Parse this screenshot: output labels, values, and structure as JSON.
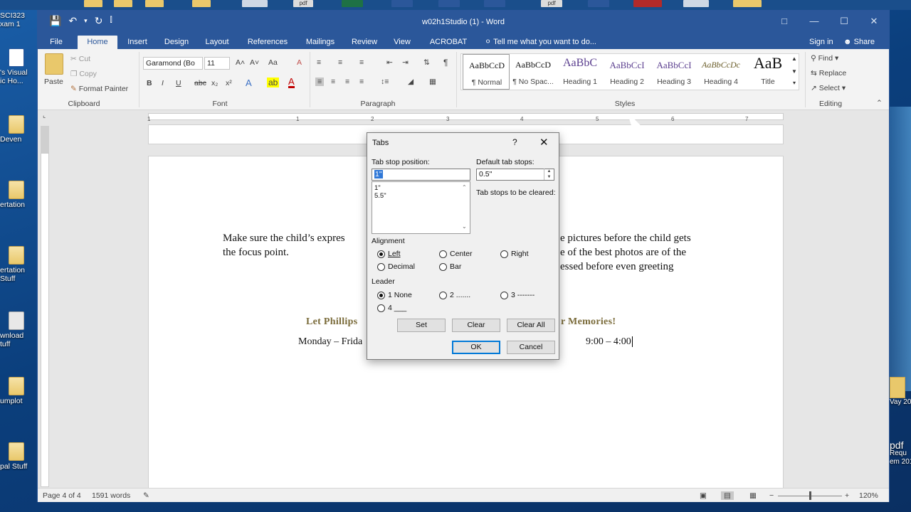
{
  "desktop": {
    "left_icons": [
      {
        "label": "SCI323",
        "label2": "xam 1"
      },
      {
        "label": "'s Visual",
        "label2": "ic Ho..."
      },
      {
        "label": "Deven",
        "label2": ""
      },
      {
        "label": "ertation",
        "label2": ""
      },
      {
        "label": "ertation",
        "label2": "Stuff"
      },
      {
        "label": "wnload",
        "label2": "tuff"
      },
      {
        "label": "umplot",
        "label2": ""
      },
      {
        "label": "pal Stuff",
        "label2": ""
      }
    ],
    "right_icons": [
      {
        "label": "Vay 20"
      },
      {
        "label": "pdf"
      },
      {
        "label": "Requ"
      },
      {
        "label": "em 201"
      }
    ],
    "top_pdf_labels": [
      "pdf",
      "pdf"
    ]
  },
  "window": {
    "title": "w02h1Studio (1) - Word",
    "qat": {
      "save": "💾",
      "undo": "↶",
      "undo_more": "▾",
      "redo": "↻",
      "customize": "⫿"
    },
    "controls": {
      "ribbon_display": "□",
      "minimize": "—",
      "maximize": "☐",
      "close": "✕"
    }
  },
  "tabs": [
    "File",
    "Home",
    "Insert",
    "Design",
    "Layout",
    "References",
    "Mailings",
    "Review",
    "View",
    "ACROBAT"
  ],
  "tell_me": "Tell me what you want to do...",
  "sign_in": "Sign in",
  "share": "Share",
  "ribbon": {
    "clipboard": {
      "paste": "Paste",
      "cut": "Cut",
      "copy": "Copy",
      "format_painter": "Format Painter",
      "label": "Clipboard"
    },
    "font": {
      "font_name": "Garamond (Bo",
      "font_size": "11",
      "label": "Font",
      "bold": "B",
      "italic": "I",
      "underline": "U",
      "strike": "abc",
      "sub": "x₂",
      "sup": "x²",
      "grow": "A˄",
      "shrink": "A˅",
      "case": "Aa",
      "clear": "A"
    },
    "paragraph": {
      "label": "Paragraph",
      "pilcrow": "¶"
    },
    "styles": {
      "label": "Styles",
      "items": [
        {
          "preview": "AaBbCcD",
          "name": "¶ Normal"
        },
        {
          "preview": "AaBbCcD",
          "name": "¶ No Spac..."
        },
        {
          "preview": "AaBbC",
          "name": "Heading 1"
        },
        {
          "preview": "AaBbCcI",
          "name": "Heading 2"
        },
        {
          "preview": "AaBbCcI",
          "name": "Heading 3"
        },
        {
          "preview": "AaBbCcDc",
          "name": "Heading 4"
        },
        {
          "preview": "AaB",
          "name": "Title"
        }
      ]
    },
    "editing": {
      "find": "Find",
      "replace": "Replace",
      "select": "Select",
      "label": "Editing"
    }
  },
  "ruler": {
    "numbers": [
      "1",
      "1",
      "2",
      "3",
      "4",
      "5",
      "6",
      "7"
    ]
  },
  "document": {
    "para_left_1": "Make sure the child’s expres",
    "para_left_2": "the focus point.",
    "para_right_1": "e pictures before the child gets",
    "para_right_2": "e of the best photos are of the",
    "para_right_3": "essed before even greeting",
    "title_left": "Let Phillips",
    "title_right": "r Memories!",
    "line_left": "Monday – Frida",
    "line_right": "9:00 – 4:00"
  },
  "status": {
    "page": "Page 4 of 4",
    "words": "1591 words",
    "zoom": "120%"
  },
  "dialog": {
    "title": "Tabs",
    "help": "?",
    "close": "✕",
    "tab_stop_label": "Tab stop position:",
    "tab_stop_value": "1\"",
    "default_label": "Default tab stops:",
    "default_value": "0.5\"",
    "to_be_cleared": "Tab stops to be cleared:",
    "list": [
      "1\"",
      "5.5\""
    ],
    "alignment_label": "Alignment",
    "alignment": [
      {
        "label": "Left",
        "selected": true
      },
      {
        "label": "Center",
        "selected": false
      },
      {
        "label": "Right",
        "selected": false
      },
      {
        "label": "Decimal",
        "selected": false
      },
      {
        "label": "Bar",
        "selected": false
      }
    ],
    "leader_label": "Leader",
    "leader": [
      {
        "label": "1 None",
        "selected": true
      },
      {
        "label": "2 .......",
        "selected": false
      },
      {
        "label": "3 -------",
        "selected": false
      },
      {
        "label": "4 ___",
        "selected": false
      }
    ],
    "buttons": {
      "set": "Set",
      "clear": "Clear",
      "clear_all": "Clear All",
      "ok": "OK",
      "cancel": "Cancel"
    }
  }
}
